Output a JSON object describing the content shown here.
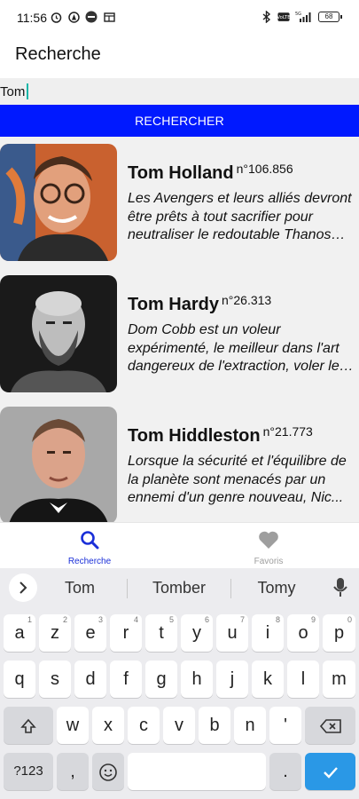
{
  "status_bar": {
    "time": "11:56",
    "left_icons": [
      "alarm-icon",
      "nav-icon",
      "app-badge-icon",
      "cast-icon"
    ],
    "right_icons": [
      "bluetooth-icon",
      "volte-icon",
      "signal-icon"
    ],
    "network": "5G",
    "battery": "68"
  },
  "app_bar": {
    "title": "Recherche"
  },
  "search": {
    "value": "Tom",
    "button_label": "RECHERCHER"
  },
  "results": [
    {
      "name": "Tom Holland",
      "popularity": "n°106.856",
      "overview": "Les Avengers et leurs alliés devront être prêts à tout sacrifier pour neutraliser le redoutable Thanos av..."
    },
    {
      "name": "Tom Hardy",
      "popularity": "n°26.313",
      "overview": "Dom Cobb est un voleur expérimenté, le meilleur dans l'art dangereux de l'extraction, voler les ..."
    },
    {
      "name": "Tom Hiddleston",
      "popularity": "n°21.773",
      "overview": "Lorsque la sécurité et l'équilibre de la planète sont menacés par un ennemi d'un genre nouveau, Nic..."
    }
  ],
  "bottom_nav": {
    "items": [
      {
        "label": "Recherche",
        "icon": "search-icon",
        "active": true
      },
      {
        "label": "Favoris",
        "icon": "heart-icon",
        "active": false
      }
    ],
    "active_color": "#0019ff",
    "inactive_color": "#9e9e9e"
  },
  "keyboard": {
    "suggestions": [
      "Tom",
      "Tomber",
      "Tomy"
    ],
    "row1": [
      {
        "k": "a",
        "h": "1"
      },
      {
        "k": "z",
        "h": "2"
      },
      {
        "k": "e",
        "h": "3"
      },
      {
        "k": "r",
        "h": "4"
      },
      {
        "k": "t",
        "h": "5"
      },
      {
        "k": "y",
        "h": "6"
      },
      {
        "k": "u",
        "h": "7"
      },
      {
        "k": "i",
        "h": "8"
      },
      {
        "k": "o",
        "h": "9"
      },
      {
        "k": "p",
        "h": "0"
      }
    ],
    "row2": [
      "q",
      "s",
      "d",
      "f",
      "g",
      "h",
      "j",
      "k",
      "l",
      "m"
    ],
    "row3": [
      "w",
      "x",
      "c",
      "v",
      "b",
      "n",
      "'"
    ],
    "symbols_label": "?123",
    "comma": ",",
    "period": ".",
    "accent_color": "#2a98e6"
  }
}
